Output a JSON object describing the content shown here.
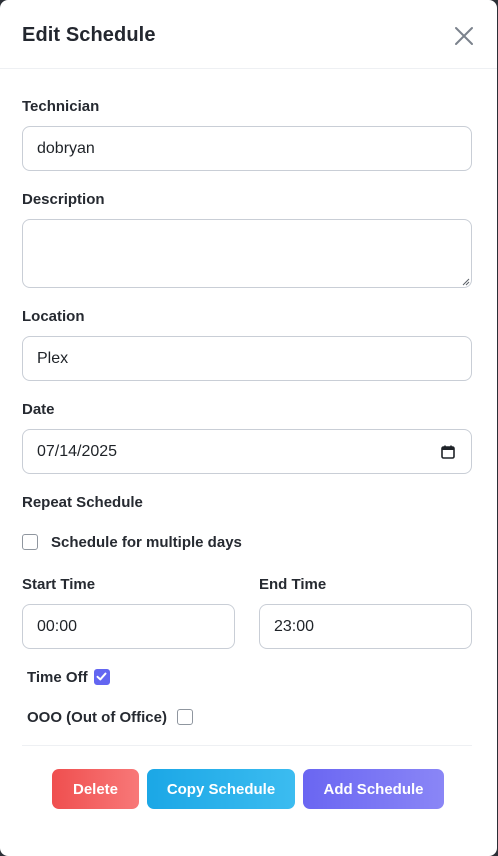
{
  "modal": {
    "title": "Edit Schedule"
  },
  "technician": {
    "label": "Technician",
    "value": "dobryan"
  },
  "description": {
    "label": "Description",
    "value": ""
  },
  "location": {
    "label": "Location",
    "value": "Plex"
  },
  "date": {
    "label": "Date",
    "value": "07/14/2025"
  },
  "repeat": {
    "label": "Repeat Schedule",
    "multiple_days_label": "Schedule for multiple days",
    "multiple_days_checked": false
  },
  "start_time": {
    "label": "Start Time",
    "value": "00:00"
  },
  "end_time": {
    "label": "End Time",
    "value": "23:00"
  },
  "time_off": {
    "label": "Time Off",
    "checked": true
  },
  "ooo": {
    "label": "OOO (Out of Office)",
    "checked": false
  },
  "buttons": {
    "delete": "Delete",
    "copy": "Copy Schedule",
    "add": "Add Schedule"
  },
  "colors": {
    "accent": "#6366f1",
    "delete": "#ef4f4f",
    "copy": "#1ba7e6",
    "add": "#6a66f2"
  },
  "icons": {
    "close": "close-icon",
    "calendar": "calendar-icon",
    "check": "checkmark-icon"
  }
}
